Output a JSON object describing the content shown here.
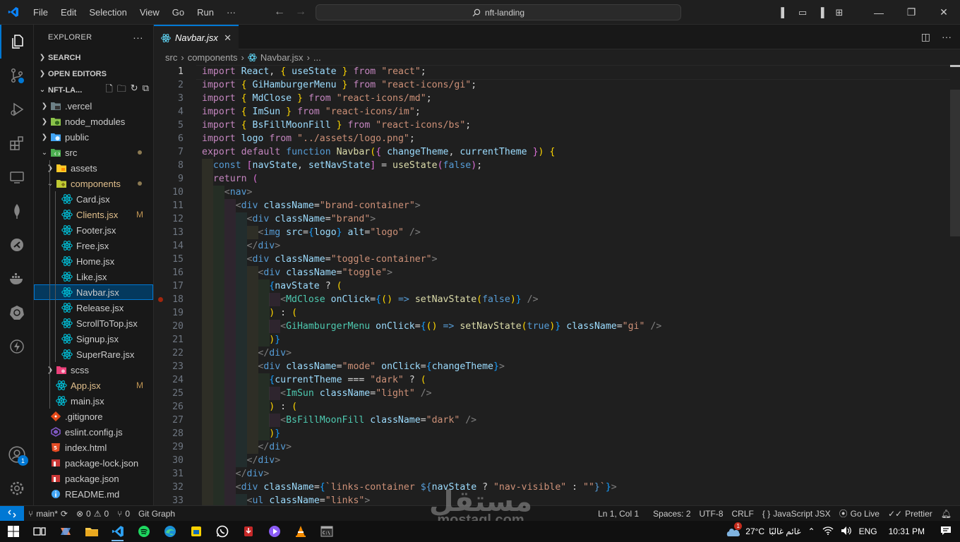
{
  "titlebar": {
    "menu": [
      "File",
      "Edit",
      "Selection",
      "View",
      "Go",
      "Run",
      "···"
    ],
    "search": "nft-landing"
  },
  "activity": {
    "account_badge": "1"
  },
  "explorer": {
    "title": "EXPLORER",
    "more": "···",
    "sections": {
      "search": "SEARCH",
      "open_editors": "OPEN EDITORS",
      "project": "NFT-LA..."
    },
    "tree": [
      {
        "name": ".vercel",
        "kind": "folder",
        "depth": 1,
        "open": false
      },
      {
        "name": "node_modules",
        "kind": "folder-node",
        "depth": 1,
        "open": false
      },
      {
        "name": "public",
        "kind": "folder-public",
        "depth": 1,
        "open": false
      },
      {
        "name": "src",
        "kind": "folder-src",
        "depth": 1,
        "open": true,
        "dot": true
      },
      {
        "name": "assets",
        "kind": "folder-assets",
        "depth": 2,
        "open": false
      },
      {
        "name": "components",
        "kind": "folder-comp",
        "depth": 2,
        "open": true,
        "dot": true,
        "modified": true
      },
      {
        "name": "Card.jsx",
        "kind": "react",
        "depth": 3
      },
      {
        "name": "Clients.jsx",
        "kind": "react",
        "depth": 3,
        "mod": "M",
        "modified": true
      },
      {
        "name": "Footer.jsx",
        "kind": "react",
        "depth": 3
      },
      {
        "name": "Free.jsx",
        "kind": "react",
        "depth": 3
      },
      {
        "name": "Home.jsx",
        "kind": "react",
        "depth": 3
      },
      {
        "name": "Like.jsx",
        "kind": "react",
        "depth": 3
      },
      {
        "name": "Navbar.jsx",
        "kind": "react",
        "depth": 3,
        "selected": true
      },
      {
        "name": "Release.jsx",
        "kind": "react",
        "depth": 3
      },
      {
        "name": "ScrollToTop.jsx",
        "kind": "react",
        "depth": 3
      },
      {
        "name": "Signup.jsx",
        "kind": "react",
        "depth": 3
      },
      {
        "name": "SuperRare.jsx",
        "kind": "react",
        "depth": 3
      },
      {
        "name": "scss",
        "kind": "folder-scss",
        "depth": 2,
        "open": false
      },
      {
        "name": "App.jsx",
        "kind": "react",
        "depth": 2,
        "mod": "M",
        "modified": true
      },
      {
        "name": "main.jsx",
        "kind": "react",
        "depth": 2
      },
      {
        "name": ".gitignore",
        "kind": "git",
        "depth": 1
      },
      {
        "name": "eslint.config.js",
        "kind": "eslint",
        "depth": 1
      },
      {
        "name": "index.html",
        "kind": "html",
        "depth": 1
      },
      {
        "name": "package-lock.json",
        "kind": "npm",
        "depth": 1
      },
      {
        "name": "package.json",
        "kind": "npm",
        "depth": 1
      },
      {
        "name": "README.md",
        "kind": "info",
        "depth": 1
      }
    ]
  },
  "editor": {
    "tab": "Navbar.jsx",
    "breadcrumb": [
      "src",
      "components",
      "Navbar.jsx",
      "..."
    ],
    "current_line": 1,
    "breakpoint_line": 18
  },
  "status": {
    "branch": "main*",
    "errors": "0",
    "warnings": "0",
    "ports": "0",
    "git_graph": "Git Graph",
    "position": "Ln 1, Col 1",
    "spaces": "Spaces: 2",
    "encoding": "UTF-8",
    "eol": "CRLF",
    "language": "JavaScript JSX",
    "golive": "Go Live",
    "prettier": "Prettier"
  },
  "taskbar": {
    "temperature": "27°C",
    "weather": "غائم غالبًا",
    "lang": "ENG",
    "time": "10:31 PM",
    "weather_badge": "1"
  },
  "watermark": {
    "arabic": "مستقل",
    "latin": "mostaql.com"
  }
}
